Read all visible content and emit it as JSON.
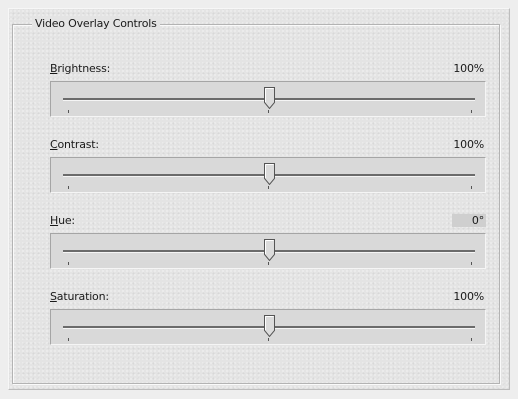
{
  "group": {
    "title": "Video Overlay Controls"
  },
  "sliders": [
    {
      "label_accel": "B",
      "label_rest": "rightness:",
      "value": "100%",
      "level": 0.5
    },
    {
      "label_accel": "C",
      "label_rest": "ontrast:",
      "value": "100%",
      "level": 0.5
    },
    {
      "label_accel": "H",
      "label_rest": "ue:",
      "value": "0°",
      "level": 0.5
    },
    {
      "label_accel": "S",
      "label_rest": "aturation:",
      "value": "100%",
      "level": 0.5
    }
  ]
}
